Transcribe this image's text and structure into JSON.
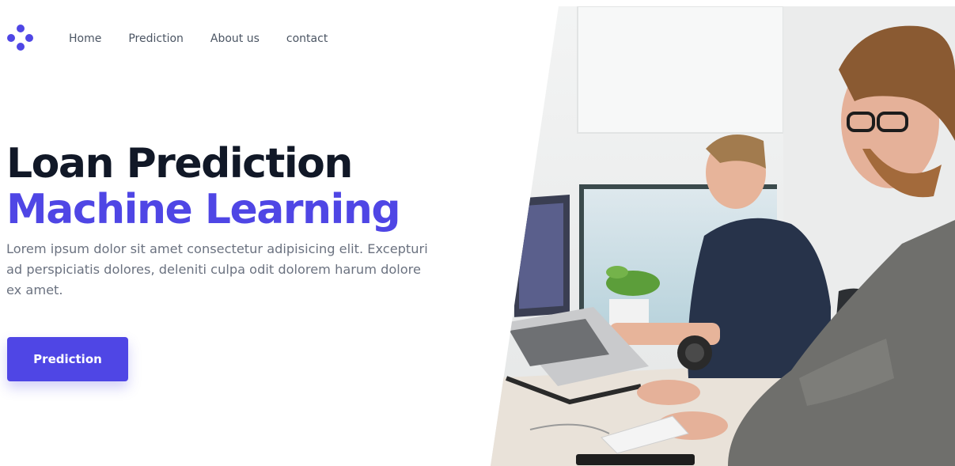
{
  "brand": {
    "logo_icon": "dots-logo-icon",
    "accent_color": "#4f46e5"
  },
  "nav": {
    "items": [
      {
        "label": "Home"
      },
      {
        "label": "Prediction"
      },
      {
        "label": "About us"
      },
      {
        "label": "contact"
      }
    ]
  },
  "hero": {
    "title_line1": "Loan Prediction",
    "title_line2": "Machine Learning",
    "description": "Lorem ipsum dolor sit amet consectetur adipisicing elit. Excepturi ad perspiciatis dolores, deleniti culpa odit dolorem harum dolore ex amet.",
    "cta_label": "Prediction"
  },
  "photo": {
    "subject": "office-workers-photo"
  }
}
